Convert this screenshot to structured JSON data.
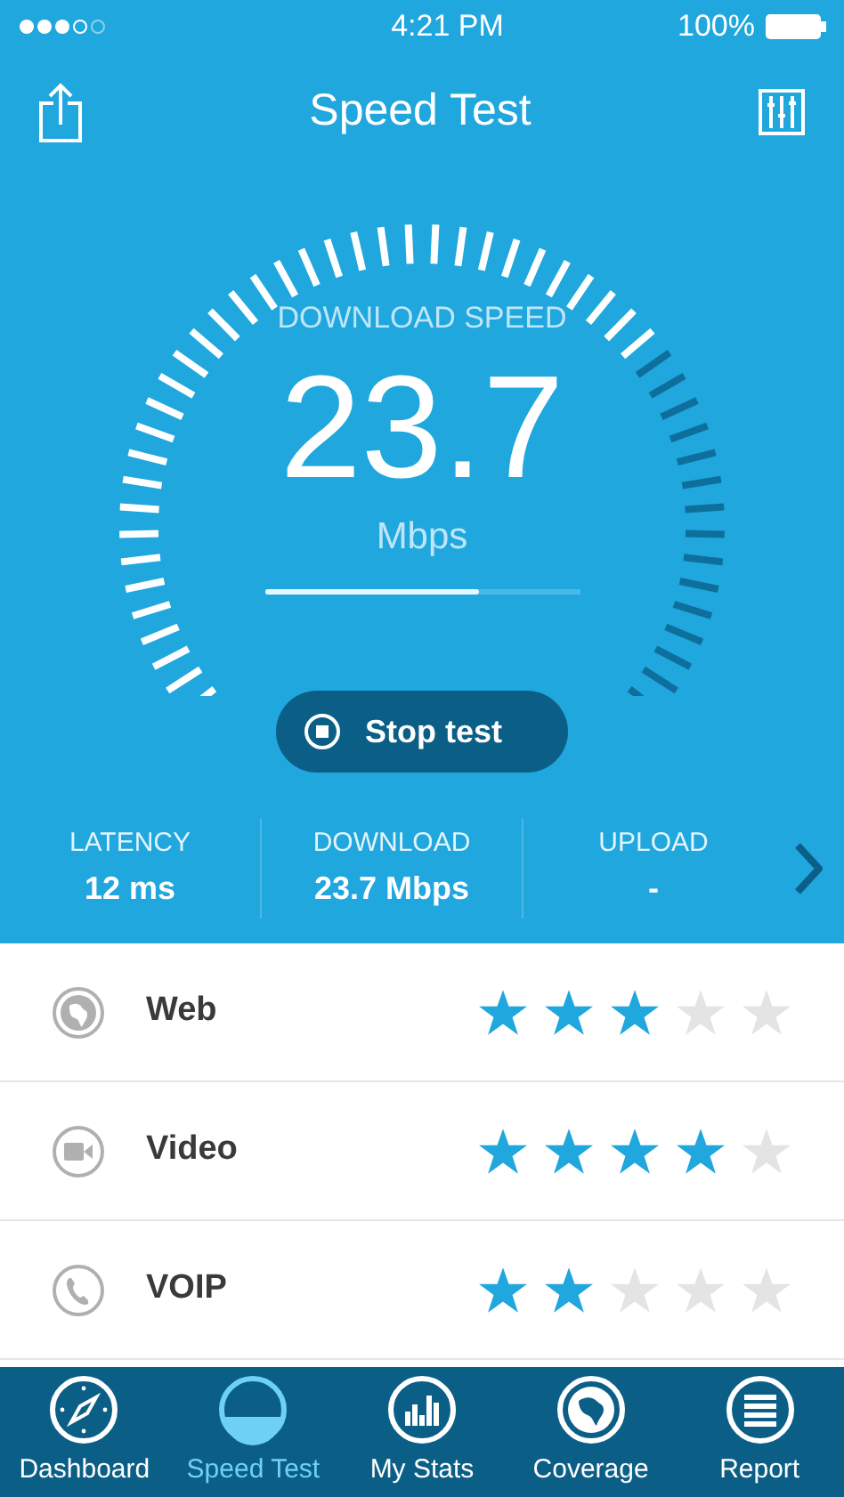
{
  "status_bar": {
    "time": "4:21 PM",
    "battery": "100%"
  },
  "header": {
    "title": "Speed Test"
  },
  "gauge": {
    "label": "DOWNLOAD SPEED",
    "value": "23.7",
    "unit": "Mbps",
    "progress": {
      "level": 0.68
    }
  },
  "stop_button": {
    "label": "Stop test"
  },
  "stats": [
    {
      "label": "LATENCY",
      "value": "12 ms"
    },
    {
      "label": "DOWNLOAD",
      "value": "23.7 Mbps"
    },
    {
      "label": "UPLOAD",
      "value": "-"
    }
  ],
  "ratings": [
    {
      "kind": "web",
      "label": "Web",
      "stars": 3
    },
    {
      "kind": "video",
      "label": "Video",
      "stars": 4
    },
    {
      "kind": "voip",
      "label": "VOIP",
      "stars": 2
    }
  ],
  "tabs": [
    {
      "kind": "dashboard",
      "label": "Dashboard",
      "selected": false
    },
    {
      "kind": "speed",
      "label": "Speed Test",
      "selected": true
    },
    {
      "kind": "stats",
      "label": "My Stats",
      "selected": false
    },
    {
      "kind": "coverage",
      "label": "Coverage",
      "selected": false
    },
    {
      "kind": "report",
      "label": "Report",
      "selected": false
    }
  ]
}
